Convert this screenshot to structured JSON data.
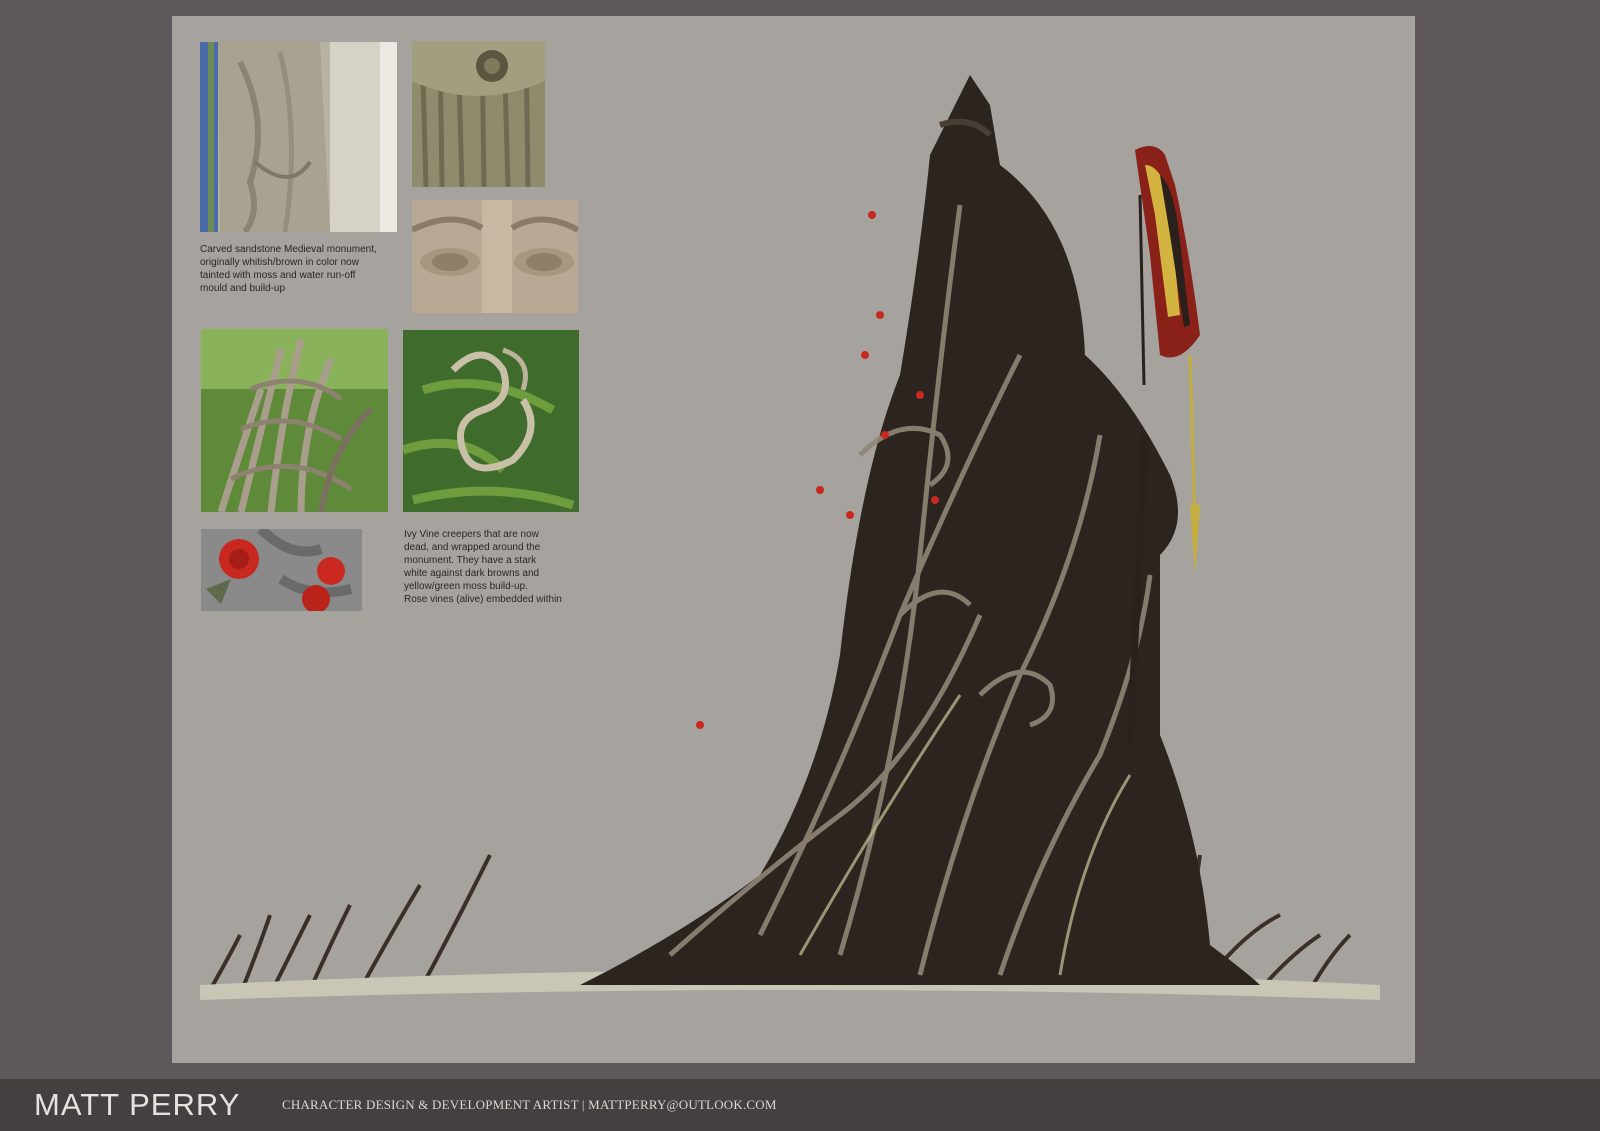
{
  "references": {
    "monument_caption": "Carved sandstone Medieval monument,\noriginally whitish/brown in color now\ntainted with moss and water run-off\nmould and build-up",
    "vine_caption": "Ivy Vine creepers that are now\ndead, and wrapped around the\nmonument.  They have a stark\nwhite against dark browns and\nyellow/green moss build-up.\nRose vines (alive) embedded within",
    "photos": [
      "stone-drapery-photo",
      "mossy-stone-photo",
      "carved-eyes-photo",
      "ivy-trunk-photo",
      "looping-vine-photo",
      "red-roses-photo"
    ]
  },
  "artwork": {
    "subject": "vine-covered-monument-with-hooded-child"
  },
  "footer": {
    "name": "MATT PERRY",
    "tagline": "CHARACTER DESIGN & DEVELOPMENT ARTIST | MATTPERRY@OUTLOOK.COM"
  },
  "colors": {
    "background": "#5e585a",
    "board": "#a6a39f",
    "footer": "#453f3f",
    "statue": "#2c241f",
    "rose": "#c8281f",
    "cloak_red": "#8a2118",
    "cloak_yellow": "#d4b441"
  }
}
